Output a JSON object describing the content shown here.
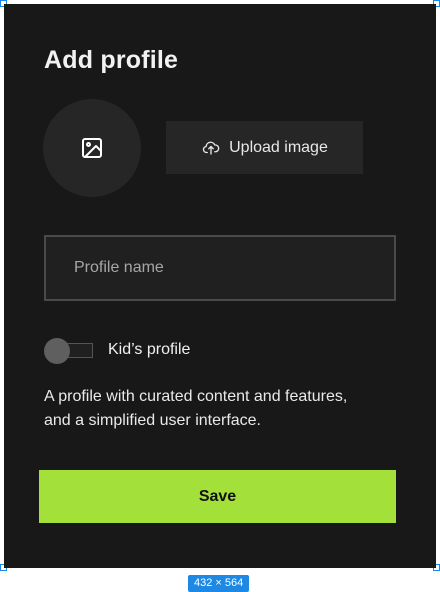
{
  "dialog": {
    "title": "Add profile",
    "upload_label": "Upload image",
    "profile_name_placeholder": "Profile name",
    "profile_name_value": "",
    "kids_profile_label": "Kid’s profile",
    "kids_profile_enabled": false,
    "description": "A profile with curated content and features, and a simplified user interface.",
    "save_label": "Save"
  },
  "editor": {
    "size_badge": "432 × 564"
  },
  "theme": {
    "panel_background": "#181818",
    "accent_green": "#a3e03a",
    "selection_blue": "#1e88e5"
  },
  "icons": {
    "avatar_placeholder": "image-icon",
    "upload": "cloud-upload-icon"
  }
}
